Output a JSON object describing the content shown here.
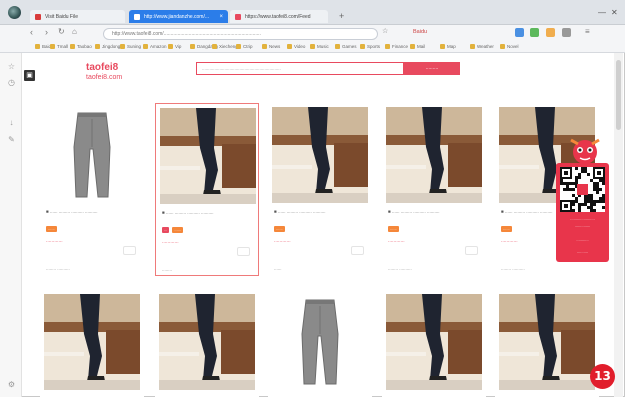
{
  "browser": {
    "tabs": [
      {
        "title": "Visit Baidu File",
        "color": "#d83b3b",
        "state": "light"
      },
      {
        "title": "http://www.jiandanzhe.com/...",
        "color": "#ffffff",
        "state": "active"
      },
      {
        "title": "https://www.taofei8.com/Feed",
        "color": "#e84a5f",
        "state": "light"
      }
    ],
    "new_tab": "+",
    "window": {
      "minimize": "—",
      "close": "✕"
    },
    "url": "http://www.taofei8.com/......................................................................",
    "search_engine": "Baidu"
  },
  "bookmarks": [
    "Baidu",
    "Tmall",
    "Taobao",
    "Jingdong",
    "Suning",
    "Amazon",
    "Vip",
    "Dangdang",
    "Xiecheng",
    "Ctrip",
    "News",
    "Video",
    "Music",
    "Games",
    "Sports",
    "Finance",
    "Mail",
    "Map",
    "Weather",
    "Novel"
  ],
  "page": {
    "logo": "taofei8",
    "logo_sub": "taofei8.com",
    "search_placeholder": "...............................................................",
    "search_button": ".........",
    "cart_icon": "▣"
  },
  "products": [
    {
      "title": "■ ...... ......... .......... ..........",
      "badges": [
        "......"
      ],
      "price": "............",
      "seller": "........ ..........",
      "image": "gray-pants"
    },
    {
      "title": "■ ...... ......... .......... ..........",
      "badges": [
        "...",
        "......"
      ],
      "price": "............",
      "seller": "........",
      "image": "floor-leg"
    },
    {
      "title": "■ ...... ......... .......... ..........",
      "badges": [
        "......"
      ],
      "price": "............",
      "seller": "......",
      "image": "floor-leg"
    },
    {
      "title": "■ ...... ......... .......... ..........",
      "badges": [
        "......"
      ],
      "price": "............",
      "seller": "........ ..........",
      "image": "floor-leg"
    },
    {
      "title": "■ ...... ......... .......... ..........",
      "badges": [
        "......"
      ],
      "price": "............",
      "seller": "........ ..........",
      "image": "floor-leg"
    },
    {
      "title": "",
      "badges": [],
      "price": "",
      "seller": "",
      "image": "floor-leg"
    },
    {
      "title": "",
      "badges": [],
      "price": "",
      "seller": "",
      "image": "floor-leg"
    },
    {
      "title": "",
      "badges": [],
      "price": "",
      "seller": "",
      "image": "gray-pants"
    },
    {
      "title": "",
      "badges": [],
      "price": "",
      "seller": "",
      "image": "floor-leg"
    },
    {
      "title": "",
      "badges": [],
      "price": "",
      "seller": "",
      "image": "floor-leg"
    }
  ],
  "qr_widget": {
    "lines": [
      "......................",
      "..............",
      "...........",
      ".........."
    ],
    "color": "#e8354b"
  },
  "step_badge": "13",
  "colors": {
    "accent": "#e84a5f",
    "tab_active": "#2b7de9"
  }
}
